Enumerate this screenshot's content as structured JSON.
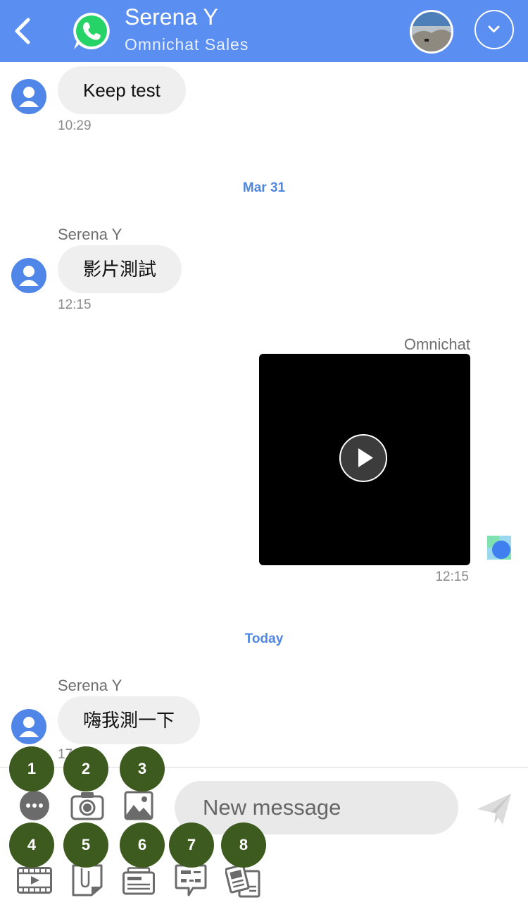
{
  "header": {
    "contact_name": "Serena Y",
    "channel": "Omnichat Sales"
  },
  "messages": [
    {
      "text": "Keep test",
      "time": "10:29"
    },
    {
      "sender": "Serena Y",
      "text": "影片測試",
      "time": "12:15"
    },
    {
      "sender": "Omnichat",
      "type": "video",
      "time": "12:15"
    },
    {
      "sender": "Serena Y",
      "text": "嗨我測一下",
      "time": "17"
    }
  ],
  "date_separators": [
    "Mar 31",
    "Today"
  ],
  "composer": {
    "placeholder": "New message"
  },
  "badges": [
    "1",
    "2",
    "3",
    "4",
    "5",
    "6",
    "7",
    "8"
  ],
  "colors": {
    "header": "#5a8ef0",
    "accent_blue": "#4f86e0",
    "bubble": "#efefef",
    "badge": "#3d5a1f",
    "whatsapp_green": "#25d366"
  },
  "icons": {
    "back": "chevron-left-icon",
    "channel": "whatsapp-icon",
    "dropdown": "chevron-down-icon",
    "more": "more-icon",
    "camera": "camera-icon",
    "image": "image-icon",
    "video": "video-icon",
    "file": "file-icon",
    "card": "card-icon",
    "template": "template-icon",
    "article": "article-icon",
    "send": "send-icon"
  }
}
